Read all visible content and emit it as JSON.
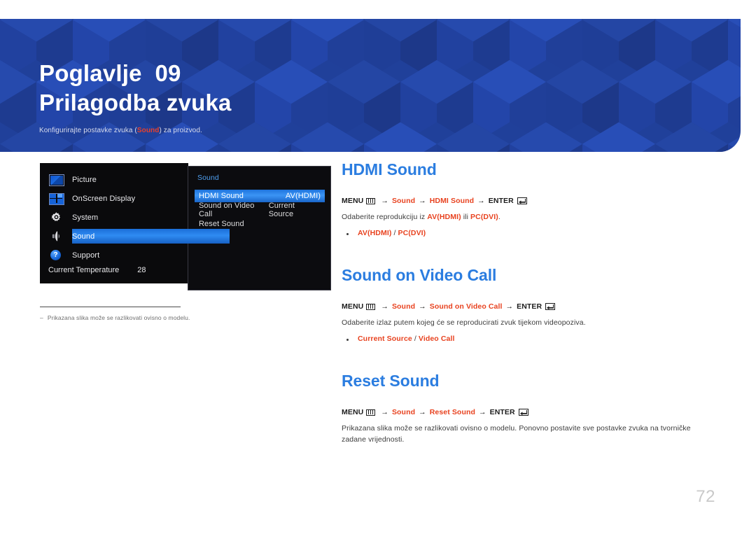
{
  "banner": {
    "chapter_label": "Poglavlje",
    "chapter_number": "09",
    "chapter_title": "Prilagodba zvuka",
    "subtitle_prefix": "Konfigurirajte postavke zvuka (",
    "subtitle_highlight": "Sound",
    "subtitle_suffix": ") za proizvod.",
    "background_color": "#20409A",
    "title_color": "#FFFFFF",
    "highlight_color": "#E8402A"
  },
  "osd": {
    "sidebar": {
      "items": [
        {
          "label": "Picture",
          "icon": "picture-icon",
          "selected": false
        },
        {
          "label": "OnScreen Display",
          "icon": "onscreen-display-icon",
          "selected": false
        },
        {
          "label": "System",
          "icon": "gear-icon",
          "selected": false
        },
        {
          "label": "Sound",
          "icon": "speaker-icon",
          "selected": true
        },
        {
          "label": "Support",
          "icon": "question-mark-icon",
          "selected": false
        }
      ],
      "temperature_label": "Current Temperature",
      "temperature_value": "28"
    },
    "panel": {
      "title": "Sound",
      "items": [
        {
          "name": "HDMI Sound",
          "value": "AV(HDMI)",
          "selected": true
        },
        {
          "name": "Sound on Video Call",
          "value": "Current Source",
          "selected": false
        },
        {
          "name": "Reset Sound",
          "value": "",
          "selected": false
        }
      ],
      "highlight_color": "#2F8BF2"
    },
    "note_dash": "–",
    "note_text": "Prikazana slika može se razlikovati ovisno o modelu."
  },
  "sections": [
    {
      "heading": "HDMI Sound",
      "menu_prefix": "MENU",
      "menu_step1": "Sound",
      "menu_step2": "HDMI Sound",
      "menu_enter": "ENTER",
      "body_pre": "Odaberite reprodukciju iz ",
      "body_b1": "AV(HDMI)",
      "body_mid": " ili ",
      "body_b2": "PC(DVI)",
      "body_post": ".",
      "bullet_a": "AV(HDMI)",
      "bullet_sep": " / ",
      "bullet_b": "PC(DVI)"
    },
    {
      "heading": "Sound on Video Call",
      "menu_prefix": "MENU",
      "menu_step1": "Sound",
      "menu_step2": "Sound on Video Call",
      "menu_enter": "ENTER",
      "body_pre": "Odaberite izlaz putem kojeg će se reproducirati zvuk tijekom videopoziva.",
      "body_b1": "",
      "body_mid": "",
      "body_b2": "",
      "body_post": "",
      "bullet_a": "Current Source",
      "bullet_sep": " / ",
      "bullet_b": "Video Call"
    },
    {
      "heading": "Reset Sound",
      "menu_prefix": "MENU",
      "menu_step1": "Sound",
      "menu_step2": "Reset Sound",
      "menu_enter": "ENTER",
      "body_pre": "Prikazana slika može se razlikovati ovisno o modelu. Ponovno postavite sve postavke zvuka na tvorničke zadane vrijednosti.",
      "body_b1": "",
      "body_mid": "",
      "body_b2": "",
      "body_post": "",
      "bullet_a": "",
      "bullet_sep": "",
      "bullet_b": ""
    }
  ],
  "arrow_glyph": "→",
  "page_number": "72",
  "colors": {
    "heading_blue": "#2B7DE0",
    "accent_orange": "#E8421F",
    "body_gray": "#3C3C3C",
    "page_number_gray": "#C9C9C9"
  }
}
